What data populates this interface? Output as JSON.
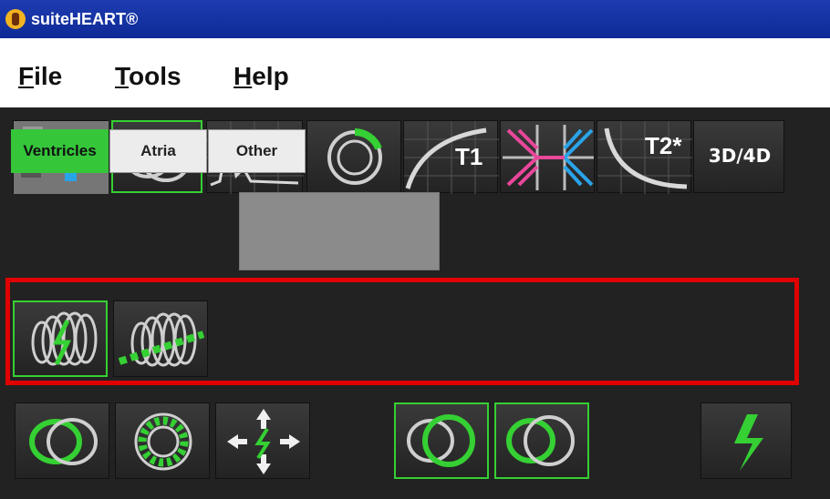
{
  "app": {
    "title": "suiteHEART®"
  },
  "menu": {
    "items": [
      {
        "key": "F",
        "rest": "ile"
      },
      {
        "key": "T",
        "rest": "ools"
      },
      {
        "key": "H",
        "rest": "elp"
      }
    ]
  },
  "toolbar_modes": [
    {
      "name": "viewer-mode-icon"
    },
    {
      "name": "function-mode-icon"
    },
    {
      "name": "flow-mode-icon"
    },
    {
      "name": "myocardial-evaluation-icon"
    },
    {
      "name": "t1-mapping-icon",
      "label": "T1"
    },
    {
      "name": "myocardial-perfusion-icon"
    },
    {
      "name": "t2-mapping-icon",
      "label": "T2*"
    },
    {
      "name": "3d-4d-icon",
      "label": "3D/4D"
    }
  ],
  "tabs": [
    "Ventricles",
    "Atria",
    "Other"
  ],
  "colors": {
    "accent_green": "#35d033",
    "highlight_red": "#e00000",
    "panel_bg": "#222222",
    "titlebar_blue": "#1536a8"
  }
}
